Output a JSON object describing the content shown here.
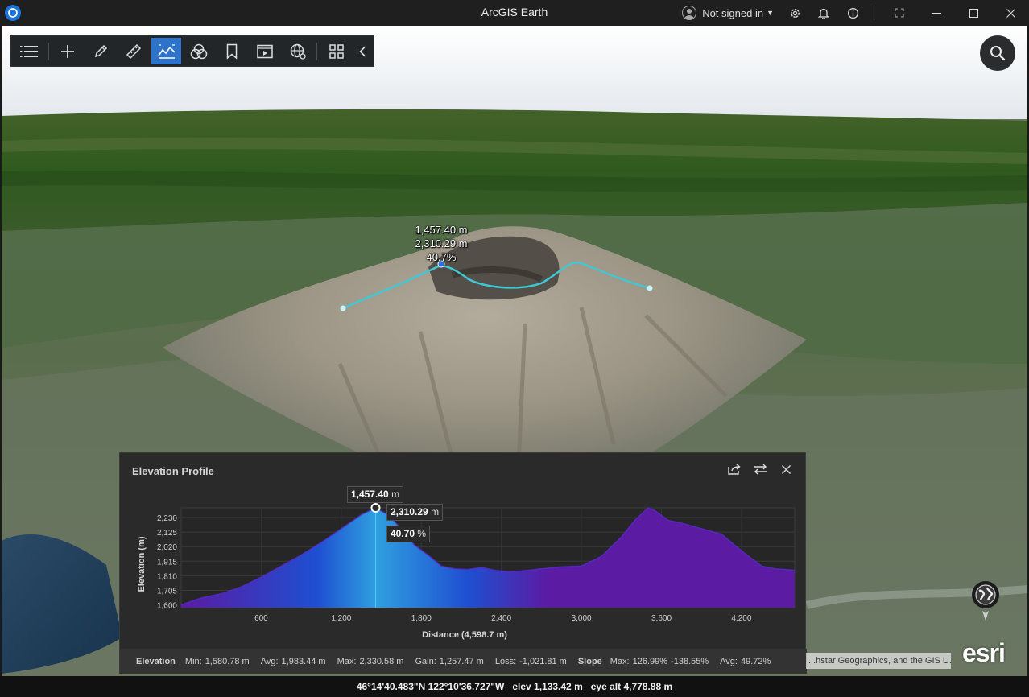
{
  "window": {
    "title": "ArcGIS Earth",
    "signin_label": "Not signed in"
  },
  "toolbar": {
    "tools": [
      "list-icon",
      "add-icon",
      "draw-icon",
      "measure-icon",
      "elevation-profile-icon",
      "analysis-icon",
      "bookmark-icon",
      "tour-icon",
      "globe-network-icon",
      "grid-icon",
      "collapse-icon"
    ],
    "active_tool": "elevation-profile-icon"
  },
  "map_labels": {
    "elevation": "1,457.40 m",
    "distance": "2,310.29 m",
    "slope": "40.7%"
  },
  "elevation_profile": {
    "title": "Elevation Profile",
    "cursor_readout": {
      "distance_value": "1,457.40",
      "distance_unit": "m",
      "elevation_value": "2,310.29",
      "elevation_unit": "m",
      "slope_value": "40.70",
      "slope_unit": "%"
    },
    "stats": {
      "elevation_label": "Elevation",
      "min_label": "Min:",
      "min_value": "1,580.78 m",
      "avg_label": "Avg:",
      "avg_value": "1,983.44 m",
      "max_label": "Max:",
      "max_value": "2,330.58 m",
      "gain_label": "Gain:",
      "gain_value": "1,257.47 m",
      "loss_label": "Loss:",
      "loss_value": "-1,021.81 m",
      "slope_label": "Slope",
      "slope_max_label": "Max:",
      "slope_max_value": "126.99%",
      "slope_min_value": "-138.55%",
      "slope_avg_label": "Avg:",
      "slope_avg_value": "49.72%"
    }
  },
  "chart_data": {
    "type": "area",
    "title": "",
    "xlabel": "Distance (4,598.7  m)",
    "ylabel": "Elevation (m)",
    "xlim": [
      0,
      4598.7
    ],
    "ylim": [
      1580,
      2300
    ],
    "x_ticks": [
      "600",
      "1,200",
      "1,800",
      "2,400",
      "3,000",
      "3,600",
      "4,200"
    ],
    "x_tick_values": [
      600,
      1200,
      1800,
      2400,
      3000,
      3600,
      4200
    ],
    "y_ticks": [
      "1,600",
      "1,705",
      "1,810",
      "1,915",
      "2,020",
      "2,125",
      "2,230"
    ],
    "y_tick_values": [
      1600,
      1705,
      1810,
      1915,
      2020,
      2125,
      2230
    ],
    "x": [
      0,
      150,
      300,
      450,
      600,
      750,
      900,
      1050,
      1200,
      1350,
      1457.4,
      1550,
      1650,
      1750,
      1850,
      1950,
      2050,
      2150,
      2250,
      2350,
      2450,
      2550,
      2700,
      2850,
      3000,
      3150,
      3300,
      3400,
      3500,
      3550,
      3650,
      3750,
      3900,
      4050,
      4200,
      4350,
      4450,
      4598.7
    ],
    "y": [
      1600,
      1650,
      1680,
      1730,
      1800,
      1880,
      1960,
      2050,
      2150,
      2250,
      2310,
      2250,
      2150,
      2030,
      1960,
      1880,
      1860,
      1855,
      1870,
      1850,
      1840,
      1845,
      1860,
      1875,
      1880,
      1950,
      2090,
      2210,
      2320,
      2280,
      2210,
      2190,
      2150,
      2110,
      1990,
      1880,
      1860,
      1850
    ],
    "cursor_x": 1457.4,
    "cursor_y": 2310.29,
    "colors": {
      "left": "#1e4fd1",
      "cursor": "#2f9fe0",
      "right": "#5b1ba3",
      "line": "#5a2bd0"
    }
  },
  "attribution": "...hstar Geographics, and the GIS U...",
  "brand": "esri",
  "status_bar": {
    "coordinates": "46°14'40.483\"N 122°10'36.727\"W",
    "elev": "elev 1,133.42 m",
    "eye_alt": "eye alt 4,778.88 m"
  }
}
